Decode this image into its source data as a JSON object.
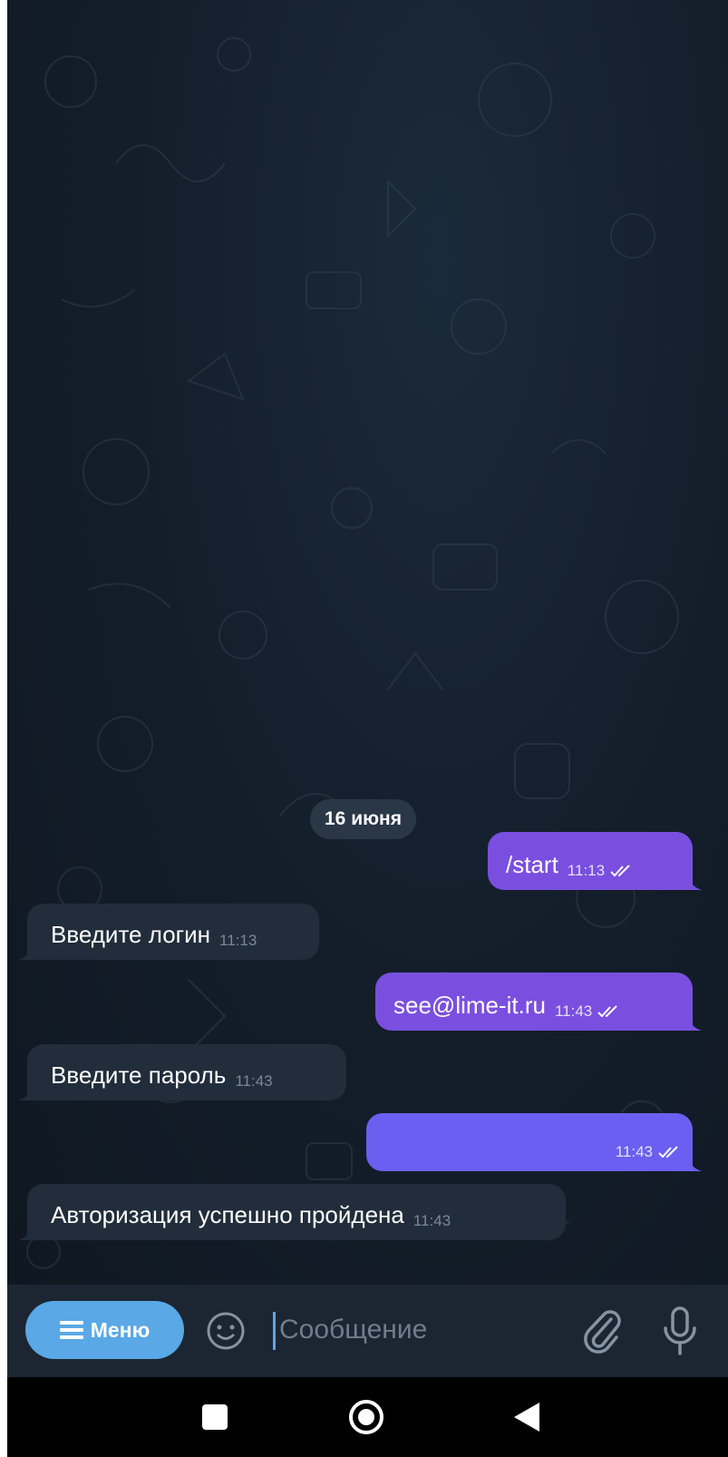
{
  "chat": {
    "date_separator": "16 июня",
    "messages": [
      {
        "direction": "outgoing",
        "text": "/start",
        "time": "11:13",
        "status": "read"
      },
      {
        "direction": "incoming",
        "text": "Введите логин",
        "time": "11:13"
      },
      {
        "direction": "outgoing",
        "text": "see@lime-it.ru",
        "time": "11:43",
        "status": "read"
      },
      {
        "direction": "incoming",
        "text": "Введите пароль",
        "time": "11:43"
      },
      {
        "direction": "outgoing",
        "text": "",
        "time": "11:43",
        "status": "read"
      },
      {
        "direction": "incoming",
        "text": "Авторизация успешно пройдена",
        "time": "11:43"
      }
    ]
  },
  "input_bar": {
    "menu_label": "Меню",
    "message_placeholder": "Сообщение",
    "message_value": ""
  },
  "icons": {
    "menu": "hamburger-icon",
    "emoji": "smiley-icon",
    "attach": "paperclip-icon",
    "voice": "microphone-icon",
    "read_status": "double-check-icon"
  },
  "colors": {
    "outgoing_bubble": "#7a4fe0",
    "outgoing_bubble_last": "#6a5ff0",
    "incoming_bubble": "#212d3b",
    "menu_button": "#5aa8e6",
    "input_bar": "#1c2633",
    "chat_background": "#141f2c"
  }
}
